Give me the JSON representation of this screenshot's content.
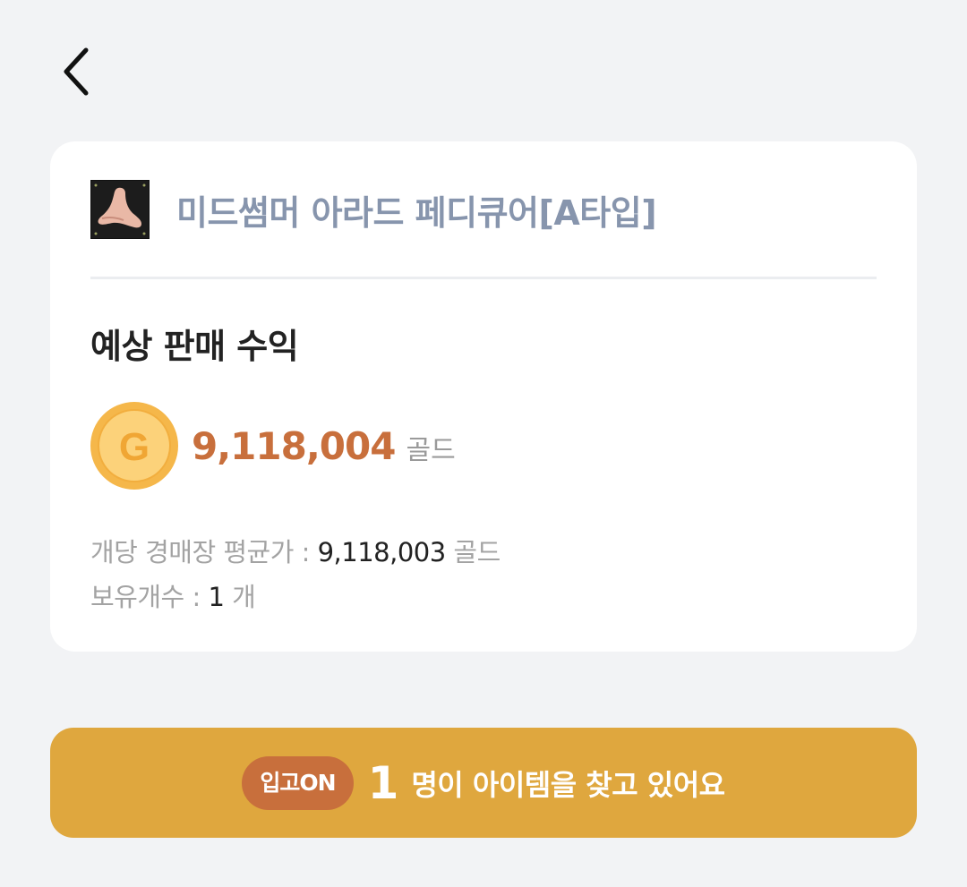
{
  "header": {
    "back_icon": "chevron-left-icon"
  },
  "item": {
    "icon": "foot-icon",
    "name": "미드썸머 아라드 페디큐어[A타입]"
  },
  "profit": {
    "title": "예상 판매 수익",
    "coin_icon": "gold-coin-icon",
    "coin_letter": "G",
    "value": "9,118,004",
    "unit": "골드"
  },
  "details": {
    "avg_label": "개당 경매장 평균가 : ",
    "avg_value": "9,118,003",
    "avg_unit": " 골드",
    "owned_label": "보유개수 : ",
    "owned_value": "1",
    "owned_unit": " 개"
  },
  "cta": {
    "badge": "입고ON",
    "count": "1",
    "text": "명이 아이템을 찾고 있어요"
  },
  "colors": {
    "background": "#f2f3f5",
    "card": "#ffffff",
    "item_name": "#8795ad",
    "profit_value": "#c86f3c",
    "cta_background": "#dfa73e",
    "cta_badge": "#c86f3c"
  }
}
